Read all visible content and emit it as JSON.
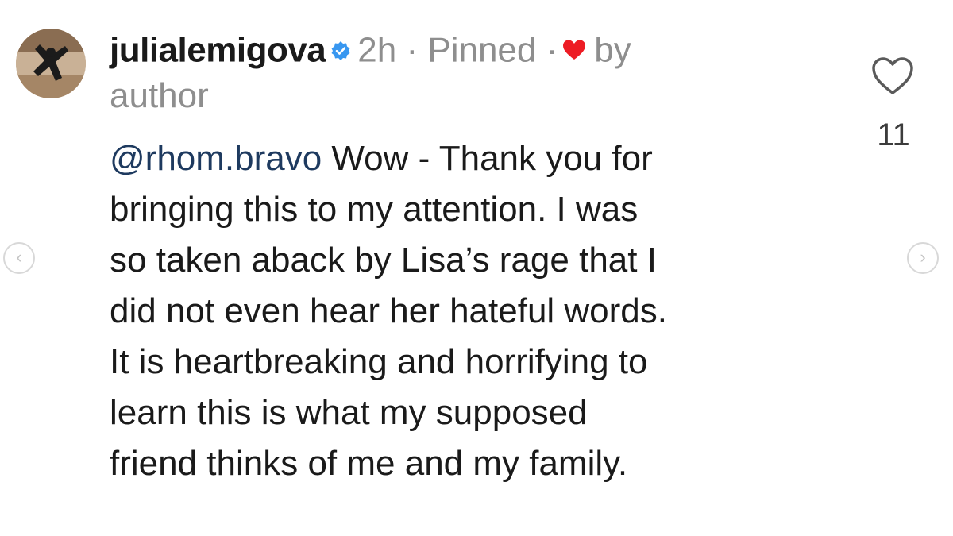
{
  "comment": {
    "username": "julialemigova",
    "verified": true,
    "time": "2h",
    "separator": "·",
    "pinned": "Pinned",
    "liked_by_label": "by",
    "author_label": "author",
    "mention": "@rhom.bravo",
    "text_after_mention": " Wow - Thank you for",
    "lines": [
      "bringing this to my attention. I was",
      "so taken aback by Lisa’s rage that I",
      "did not even hear her hateful words.",
      "It is heartbreaking and horrifying to",
      "learn this is what my supposed",
      "friend thinks of me and my family."
    ]
  },
  "likes": {
    "count": "11"
  },
  "navigation": {
    "prev_glyph": "‹",
    "next_glyph": "›"
  },
  "colors": {
    "verified_badge": "#3897f0",
    "heart": "#ed1c24",
    "mention": "#1e3a5f",
    "meta_gray": "#8e8e8e"
  },
  "icons": {
    "avatar": "avatar",
    "verified": "verified-badge-icon",
    "liked_heart": "heart-filled-icon",
    "like_button": "heart-outline-icon"
  }
}
